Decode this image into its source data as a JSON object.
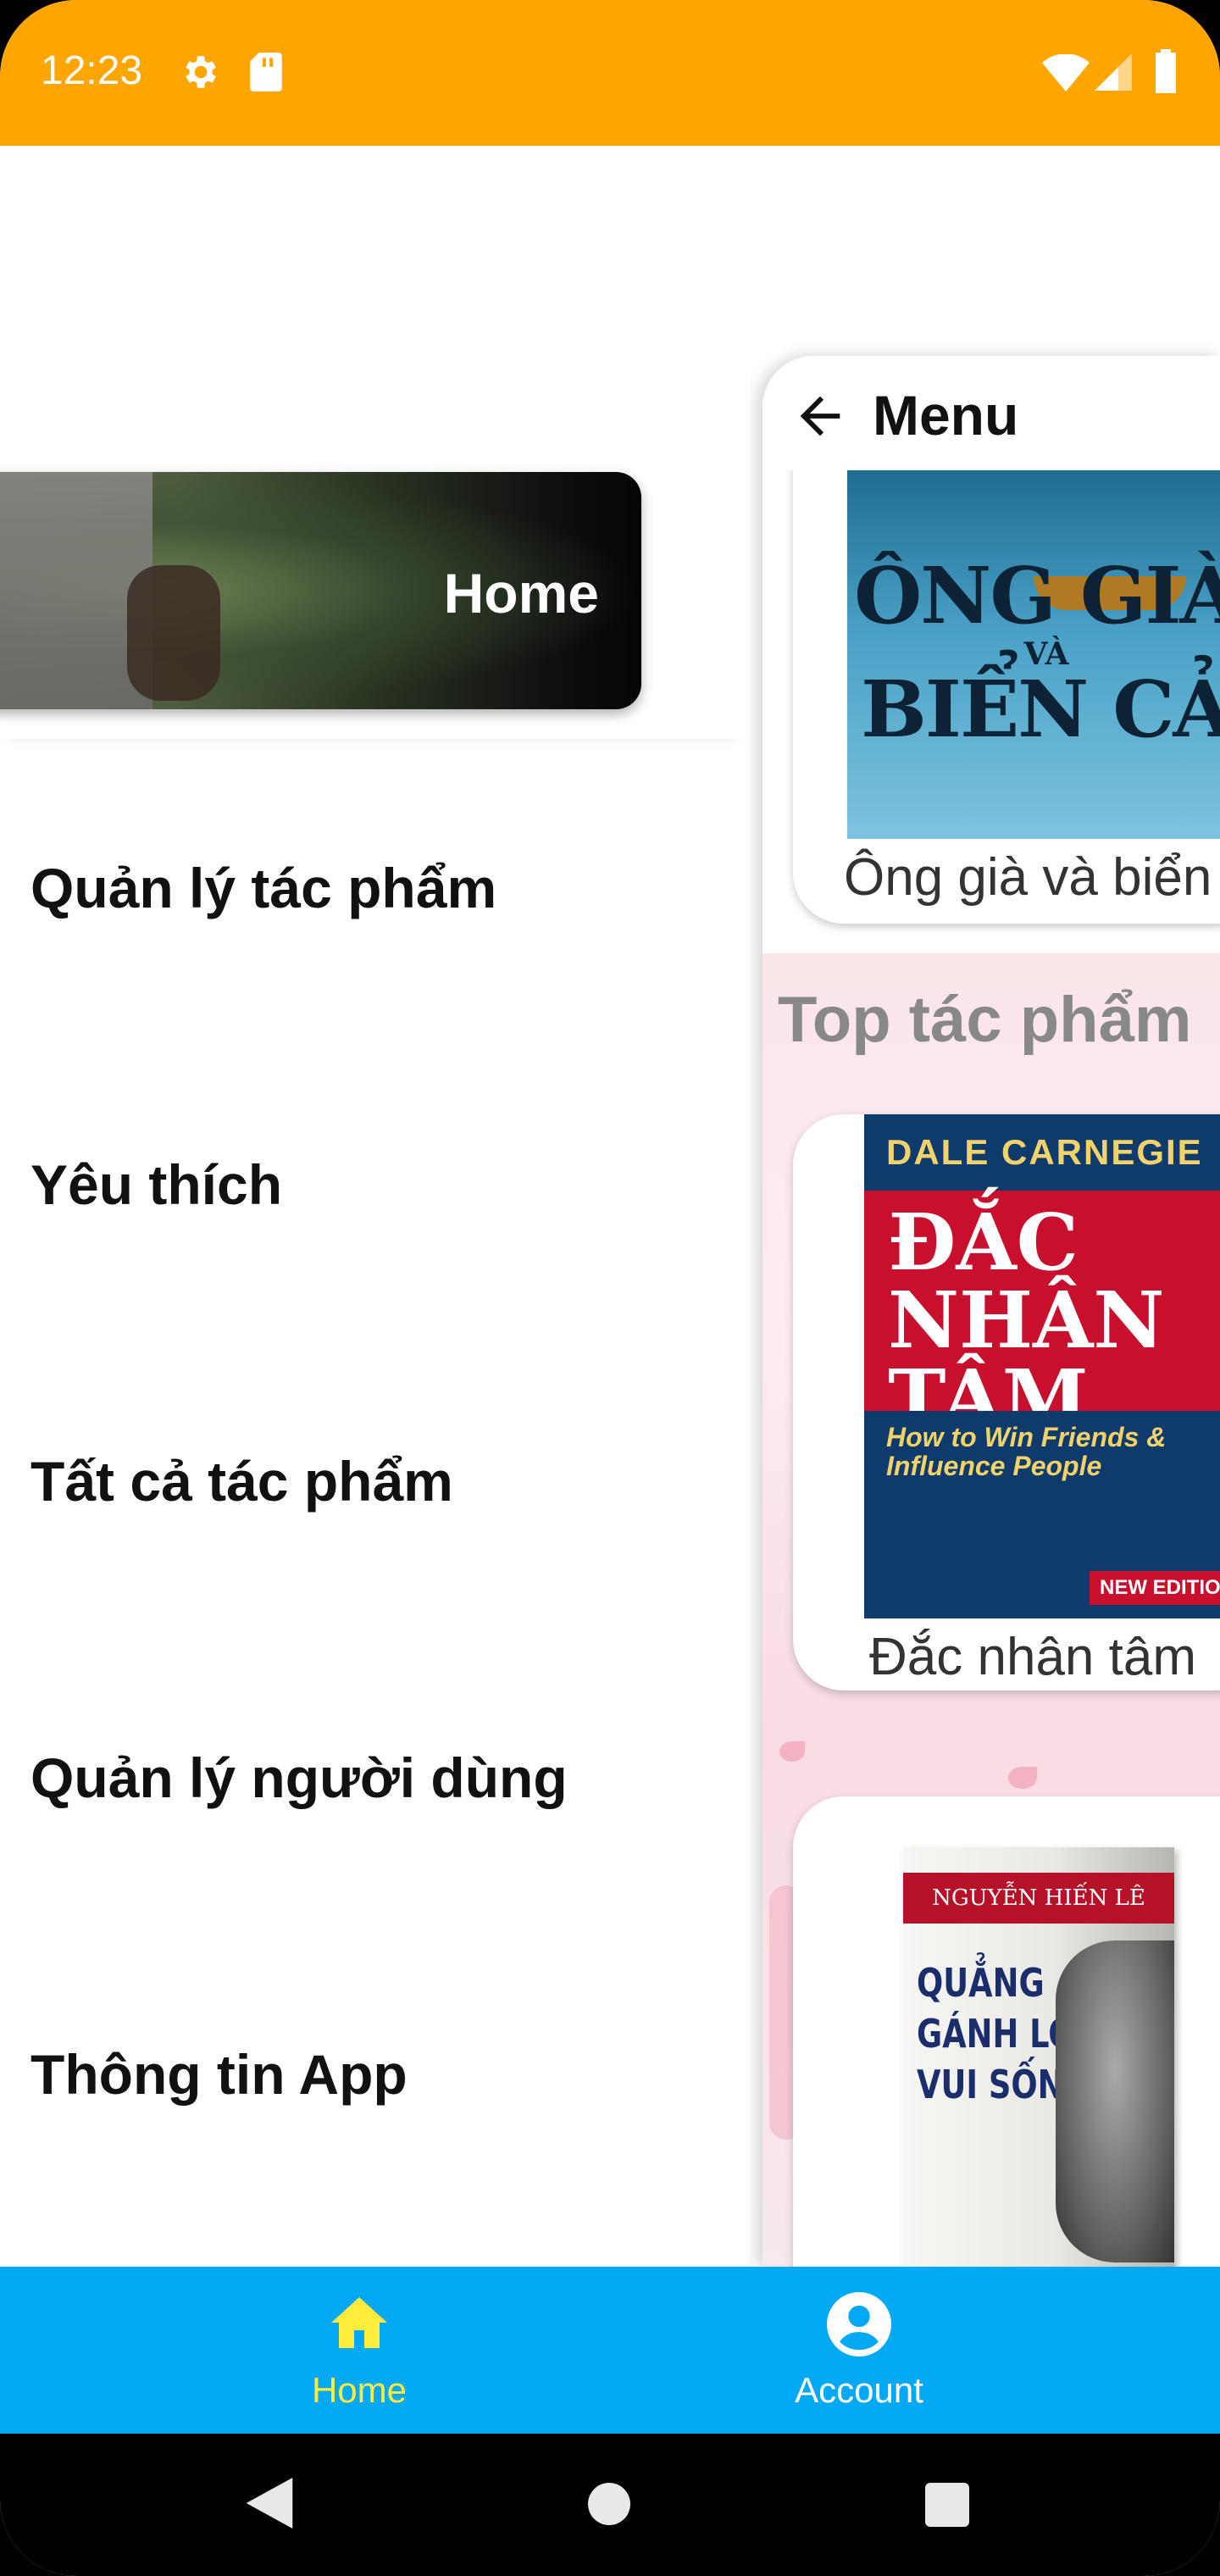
{
  "status_bar": {
    "time": "12:23",
    "background": "#FFA500",
    "icons": [
      "gear-icon",
      "sd-card-icon",
      "wifi-icon",
      "signal-icon",
      "battery-icon"
    ]
  },
  "content": {
    "header_title": "Menu",
    "books_top": [
      {
        "title": "Ông già và biển cả",
        "cover_line1": "ÔNG GIÀ",
        "cover_line2": "VÀ",
        "cover_line3": "BIỂN CẢ"
      }
    ],
    "section_title": "Top tác phẩm",
    "books_section": [
      {
        "title": "Đắc nhân tâm",
        "cover_author": "DALE CARNEGIE",
        "cover_main": [
          "ĐẮC",
          "NHÂN",
          "TÂM"
        ],
        "cover_subtitle": "How to Win Friends & Influence People",
        "cover_badge": "NEW EDITION"
      },
      {
        "title": "",
        "cover_author": "NGUYỄN HIẾN LÊ",
        "cover_main": [
          "QUẲNG",
          "GÁNH LO",
          "VUI SỐNG"
        ]
      }
    ]
  },
  "drawer": {
    "header_label": "Home",
    "items": [
      {
        "label": "Quản lý tác phẩm"
      },
      {
        "label": "Yêu thích"
      },
      {
        "label": "Tất cả tác phẩm"
      },
      {
        "label": "Quản lý người dùng"
      },
      {
        "label": "Thông tin App"
      }
    ]
  },
  "bottom_nav": {
    "background": "#03A9F4",
    "active_color": "#FFEB3B",
    "items": [
      {
        "label": "Home",
        "icon": "home-icon",
        "active": true
      },
      {
        "label": "Account",
        "icon": "account-icon",
        "active": false
      }
    ]
  },
  "system_nav": {
    "icons": [
      "back-icon",
      "home-circle-icon",
      "recents-icon"
    ]
  }
}
